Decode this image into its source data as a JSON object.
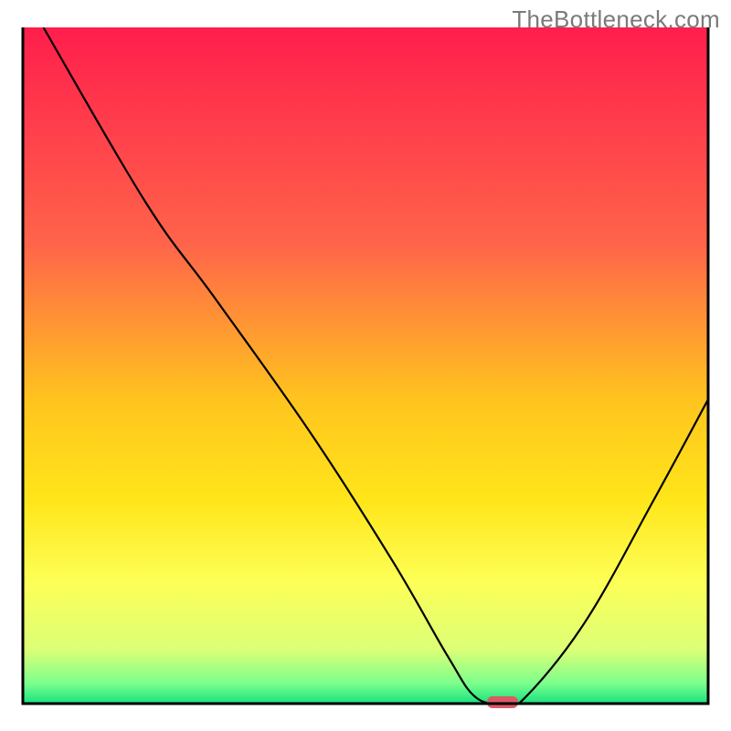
{
  "watermark": "TheBottleneck.com",
  "chart_data": {
    "type": "line",
    "title": "",
    "xlabel": "",
    "ylabel": "",
    "xlim": [
      0,
      100
    ],
    "ylim": [
      0,
      100
    ],
    "background_gradient_stops": [
      {
        "offset": 0,
        "color": "#ff1e4c"
      },
      {
        "offset": 32,
        "color": "#ff644a"
      },
      {
        "offset": 55,
        "color": "#ffc41e"
      },
      {
        "offset": 70,
        "color": "#ffe61a"
      },
      {
        "offset": 82,
        "color": "#fdff57"
      },
      {
        "offset": 92,
        "color": "#dcff77"
      },
      {
        "offset": 97,
        "color": "#7cff8c"
      },
      {
        "offset": 100,
        "color": "#18e27f"
      }
    ],
    "series": [
      {
        "name": "bottleneck-curve",
        "color": "#000000",
        "points": [
          {
            "x": 3,
            "y": 100
          },
          {
            "x": 18,
            "y": 74
          },
          {
            "x": 28,
            "y": 60
          },
          {
            "x": 42,
            "y": 40
          },
          {
            "x": 54,
            "y": 21
          },
          {
            "x": 62,
            "y": 7
          },
          {
            "x": 66,
            "y": 1
          },
          {
            "x": 70,
            "y": 0
          },
          {
            "x": 73,
            "y": 0.6
          },
          {
            "x": 82,
            "y": 12
          },
          {
            "x": 92,
            "y": 30
          },
          {
            "x": 100,
            "y": 45
          }
        ]
      }
    ],
    "marker": {
      "name": "optimal-point",
      "x": 70,
      "y": 0,
      "color": "#db5a64"
    },
    "frame_line_width": 3
  }
}
